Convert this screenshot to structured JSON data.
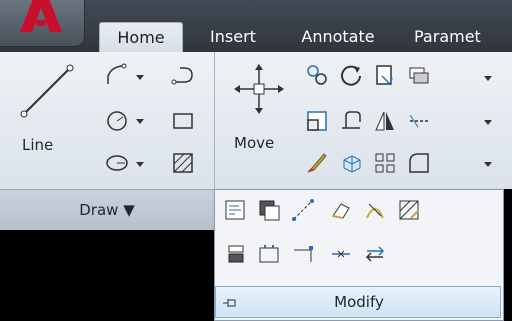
{
  "tabs": [
    {
      "label": "Home",
      "active": true
    },
    {
      "label": "Insert"
    },
    {
      "label": "Annotate"
    },
    {
      "label": "Paramet"
    }
  ],
  "draw_panel": {
    "line_label": "Line",
    "panel_title": "Draw ▼"
  },
  "modify_panel": {
    "move_label": "Move",
    "footer_label": "Modify"
  },
  "colors": {
    "ribbon_bg": "#e6ebf1",
    "app_red": "#c8102e",
    "footer_highlight": "#cfe3f4"
  }
}
